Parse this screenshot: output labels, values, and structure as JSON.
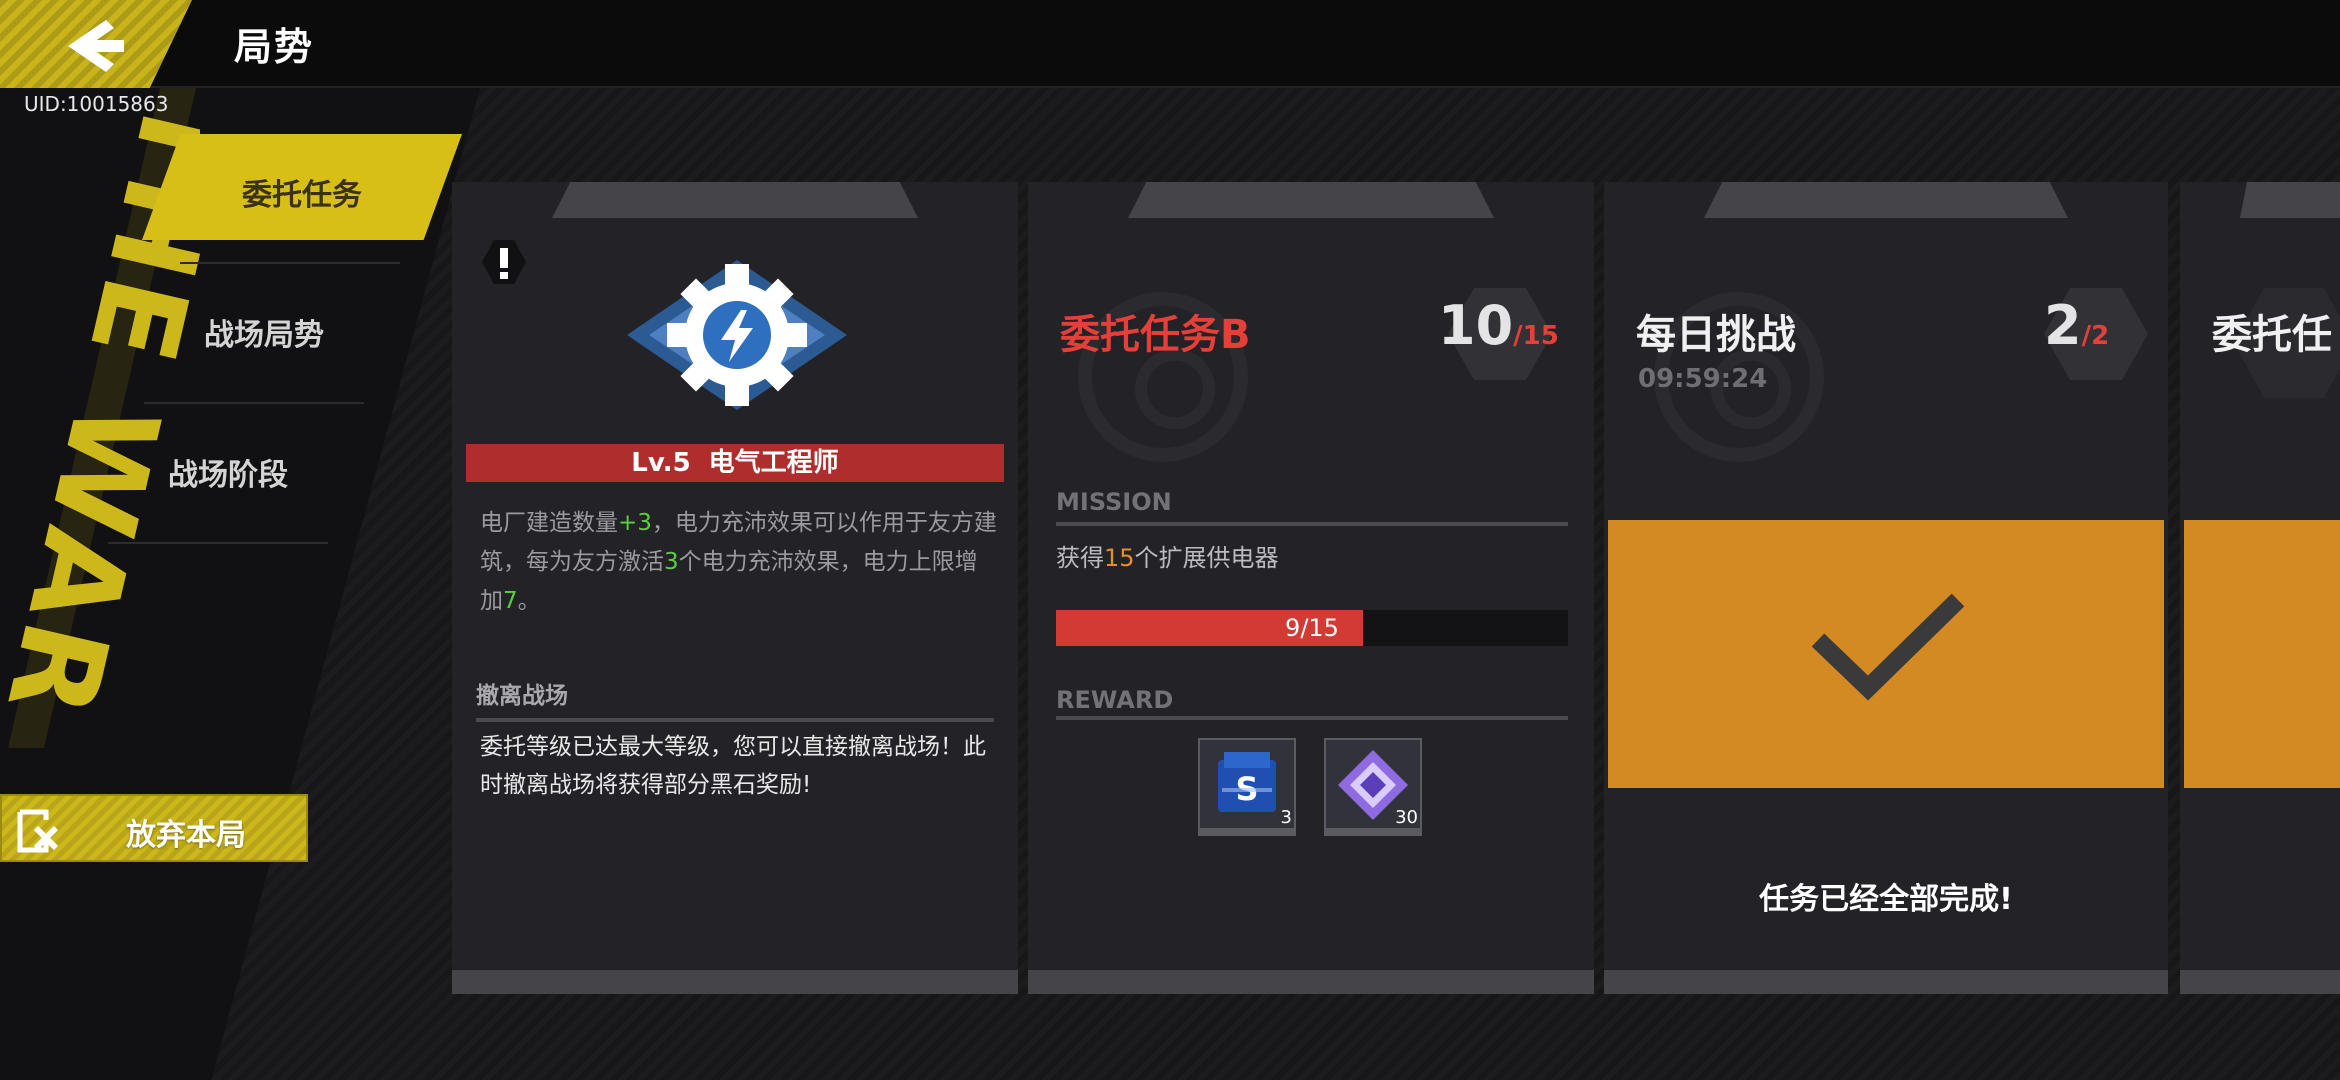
{
  "header": {
    "title": "局势",
    "uid": "UID:10015863"
  },
  "sidebar": {
    "deco_text": "THE WAR",
    "items": [
      {
        "label": "委托任务",
        "active": true
      },
      {
        "label": "战场局势",
        "active": false
      },
      {
        "label": "战场阶段",
        "active": false
      }
    ],
    "abandon_label": "放弃本局"
  },
  "talent_card": {
    "level": "Lv.5",
    "name": "电气工程师",
    "desc_parts": [
      "电厂建造数量",
      "+3",
      "，电力充沛效果可以作用于友方建筑，每为友方激活",
      "3",
      "个电力充沛效果，电力上限增加",
      "7",
      "。"
    ],
    "evac_title": "撤离战场",
    "evac_text": "委托等级已达最大等级，您可以直接撤离战场！此时撤离战场将获得部分黑石奖励!"
  },
  "mission_card": {
    "title": "委托任务B",
    "count_current": "10",
    "count_total": "/15",
    "mission_label": "MISSION",
    "desc_parts": [
      "获得",
      "15",
      "个扩展供电器"
    ],
    "progress_text": "9/15",
    "progress_fraction": 0.6,
    "reward_label": "REWARD",
    "rewards": [
      {
        "icon": "blue-s-card-icon",
        "qty": "3"
      },
      {
        "icon": "purple-crystal-icon",
        "qty": "30"
      }
    ]
  },
  "daily_card": {
    "title": "每日挑战",
    "timer": "09:59:24",
    "count_current": "2",
    "count_total": "/2",
    "done_text": "任务已经全部完成!"
  },
  "card4": {
    "title": "委托任"
  },
  "colors": {
    "accent_yellow": "#d8bf18",
    "alert_red": "#e53f3a",
    "complete_orange": "#d48a22",
    "positive_green": "#59d13a"
  }
}
